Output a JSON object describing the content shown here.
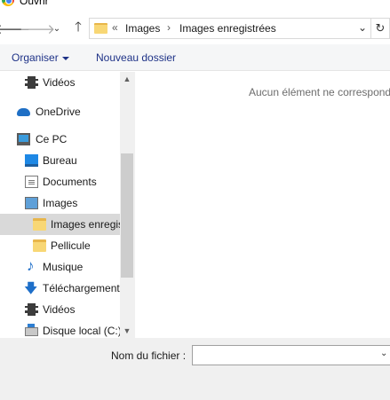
{
  "window": {
    "title": "Ouvrir",
    "icon": "chrome-icon"
  },
  "navigation": {
    "back_icon": "arrow-left-icon",
    "forward_icon": "arrow-right-icon",
    "recent_icon": "chevron-down-icon",
    "up_icon": "arrow-up-icon"
  },
  "address": {
    "overflow": "«",
    "crumbs": [
      "Images",
      "Images enregistrées"
    ],
    "separator": "›",
    "dropdown_icon": "chevron-down-icon",
    "refresh_icon": "refresh-icon"
  },
  "toolbar": {
    "organize_label": "Organiser",
    "new_folder_label": "Nouveau dossier"
  },
  "sidebar": {
    "items": [
      {
        "label": "Vidéos",
        "icon": "video-icon"
      },
      {
        "label": "OneDrive",
        "icon": "cloud-icon"
      },
      {
        "label": "Ce PC",
        "icon": "computer-icon"
      },
      {
        "label": "Bureau",
        "icon": "desktop-icon"
      },
      {
        "label": "Documents",
        "icon": "document-icon"
      },
      {
        "label": "Images",
        "icon": "image-icon"
      },
      {
        "label": "Images enregis",
        "icon": "folder-icon",
        "selected": true
      },
      {
        "label": "Pellicule",
        "icon": "folder-icon"
      },
      {
        "label": "Musique",
        "icon": "music-icon"
      },
      {
        "label": "Téléchargement",
        "icon": "download-icon"
      },
      {
        "label": "Vidéos",
        "icon": "video-icon"
      },
      {
        "label": "Disque local (C:)",
        "icon": "disk-icon"
      }
    ]
  },
  "content": {
    "empty_message": "Aucun élément ne correspond"
  },
  "footer": {
    "filename_label": "Nom du fichier :",
    "filename_value": "",
    "filename_dropdown_icon": "chevron-down-icon"
  }
}
